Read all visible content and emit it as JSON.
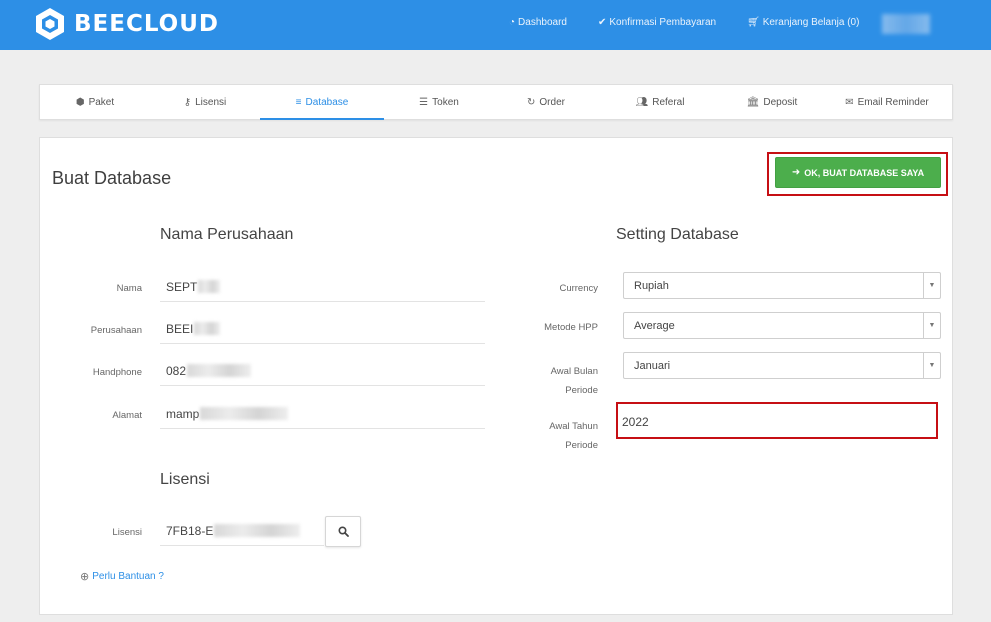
{
  "brand": {
    "name": "BEECLOUD"
  },
  "topnav": [
    {
      "label": "Dashboard",
      "icon": "dashboard-icon"
    },
    {
      "label": "Konfirmasi Pembayaran",
      "icon": "check-icon"
    },
    {
      "label": "Keranjang Belanja (0)",
      "icon": "cart-icon"
    }
  ],
  "tabs": [
    {
      "label": "Paket",
      "icon": "cube-icon"
    },
    {
      "label": "Lisensi",
      "icon": "key-icon"
    },
    {
      "label": "Database",
      "icon": "database-icon",
      "active": true
    },
    {
      "label": "Token",
      "icon": "list-icon"
    },
    {
      "label": "Order",
      "icon": "refresh-icon"
    },
    {
      "label": "Referal",
      "icon": "users-icon"
    },
    {
      "label": "Deposit",
      "icon": "bank-icon"
    },
    {
      "label": "Email Reminder",
      "icon": "envelope-icon"
    }
  ],
  "page": {
    "title": "Buat Database",
    "ok_button": "OK, BUAT DATABASE SAYA"
  },
  "company": {
    "title": "Nama Perusahaan",
    "fields": [
      {
        "label": "Nama",
        "value": "SEPT"
      },
      {
        "label": "Perusahaan",
        "value": "BEEI"
      },
      {
        "label": "Handphone",
        "value": "082"
      },
      {
        "label": "Alamat",
        "value": "mamp"
      }
    ]
  },
  "settings": {
    "title": "Setting Database",
    "currency_label": "Currency",
    "currency_value": "Rupiah",
    "hpp_label": "Metode HPP",
    "hpp_value": "Average",
    "bulan_label_1": "Awal Bulan",
    "bulan_label_2": "Periode",
    "bulan_value": "Januari",
    "tahun_label_1": "Awal Tahun",
    "tahun_label_2": "Periode",
    "tahun_value": "2022"
  },
  "license": {
    "title": "Lisensi",
    "label": "Lisensi",
    "value": "7FB18-E"
  },
  "help": {
    "label": "Perlu Bantuan ?"
  },
  "colors": {
    "primary": "#2d8fe6",
    "success": "#4cae4c",
    "highlight": "#c60f14"
  }
}
